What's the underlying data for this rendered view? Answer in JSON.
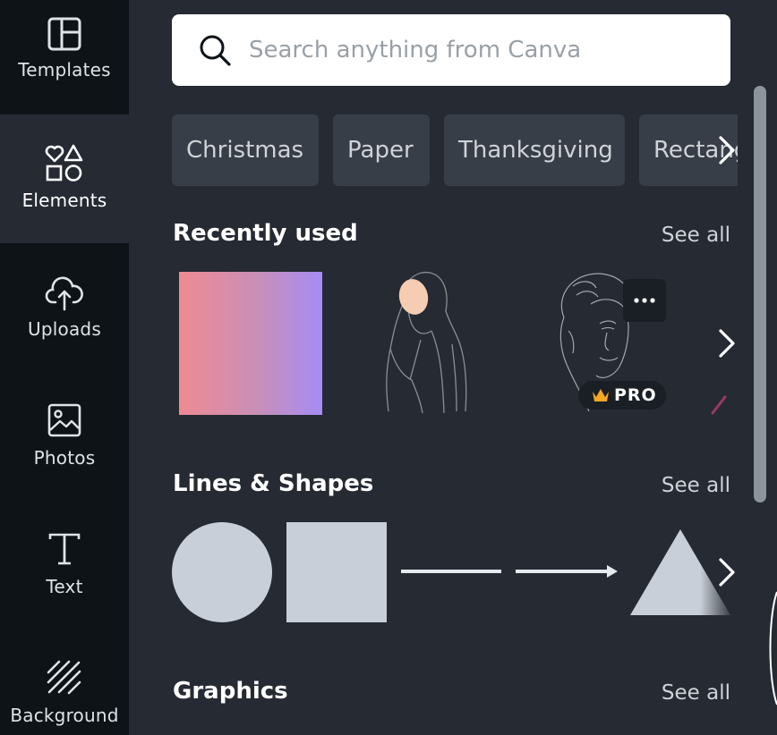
{
  "sidebar": {
    "items": [
      {
        "label": "Templates",
        "icon": "templates-icon"
      },
      {
        "label": "Elements",
        "icon": "elements-icon",
        "active": true
      },
      {
        "label": "Uploads",
        "icon": "upload-cloud-icon"
      },
      {
        "label": "Photos",
        "icon": "image-icon"
      },
      {
        "label": "Text",
        "icon": "text-icon"
      },
      {
        "label": "Background",
        "icon": "background-stripes-icon"
      }
    ]
  },
  "search": {
    "placeholder": "Search anything from Canva",
    "value": ""
  },
  "chips": [
    "Christmas",
    "Paper",
    "Thanksgiving",
    "Rectangle"
  ],
  "recently_used": {
    "title": "Recently used",
    "see_all": "See all",
    "pro_badge": "PRO",
    "more_icon": "more-dots-icon"
  },
  "lines_shapes": {
    "title": "Lines & Shapes",
    "see_all": "See all"
  },
  "graphics": {
    "title": "Graphics",
    "see_all": "See all"
  },
  "colors": {
    "sidebar_bg": "#0e1318",
    "panel_bg": "#252a33",
    "chip_bg": "#383e47",
    "shape_fill": "#c9cfd8",
    "crown": "#f5a623"
  }
}
